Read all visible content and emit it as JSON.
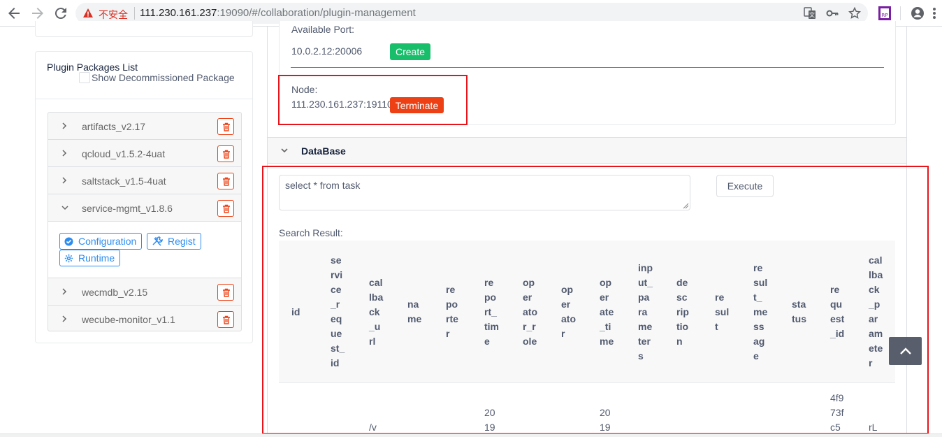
{
  "browser": {
    "security_label": "不安全",
    "url_host": "111.230.161.237",
    "url_rest": ":19090/#/collaboration/plugin-management"
  },
  "sidebar": {
    "title": "Plugin Packages List",
    "show_decommissioned_label": "Show Decommissioned Package",
    "packages": [
      {
        "name": "artifacts_v2.17"
      },
      {
        "name": "qcloud_v1.5.2-4uat"
      },
      {
        "name": "saltstack_v1.5-4uat"
      },
      {
        "name": "service-mgmt_v1.8.6"
      },
      {
        "name": "wecmdb_v2.15"
      },
      {
        "name": "wecube-monitor_v1.1"
      }
    ],
    "expanded_actions": {
      "configuration": "Configuration",
      "regist": "Regist",
      "runtime": "Runtime"
    }
  },
  "runtime": {
    "available_port_label": "Available Port:",
    "available_port_value": "10.0.2.12:20006",
    "create_label": "Create",
    "node_label": "Node:",
    "node_value": "111.230.161.237:19110",
    "terminate_label": "Terminate"
  },
  "database": {
    "section_title": "DataBase",
    "query": "select * from task",
    "execute_label": "Execute",
    "search_result_label": "Search Result:",
    "columns": [
      "id",
      "service_request_id",
      "callback_url",
      "name",
      "reporter",
      "report_time",
      "operator_role",
      "operator",
      "operate_time",
      "input_parameters",
      "description",
      "result",
      "result_message",
      "status",
      "request_id",
      "callback_parameter"
    ],
    "first_row_partial": {
      "callback_url": "/v",
      "report_time": "2019",
      "operate_time": "2019",
      "request_id": "4f973fc5",
      "callback_parameter": "rL"
    }
  },
  "colors": {
    "primary": "#2d8cf0",
    "success": "#19be6b",
    "error": "#ed4014",
    "highlight_box": "#e8141b"
  }
}
